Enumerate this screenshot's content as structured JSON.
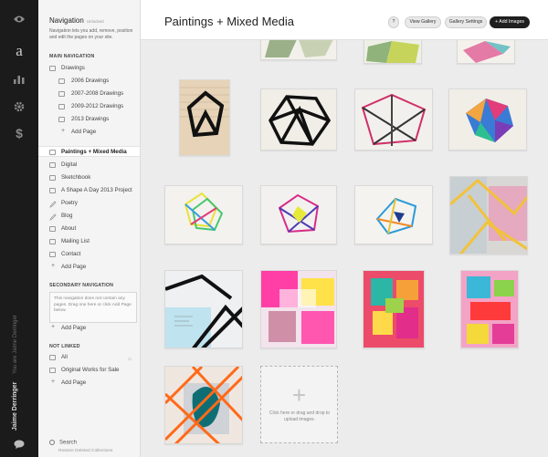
{
  "rail": {
    "icons": [
      "eye-icon",
      "logo-a-icon",
      "stats-icon",
      "settings-icon",
      "dollar-icon",
      "chat-icon"
    ],
    "logo_glyph": "a",
    "signed_in_text": "You are Jaime Derringer",
    "user_name": "Jaime Derringer"
  },
  "nav": {
    "title": "Navigation",
    "title_sub": "Unlocked",
    "description": "Navigation lets you add, remove, position and edit the pages on your site.",
    "main_heading": "MAIN NAVIGATION",
    "main_items": [
      {
        "label": "Drawings",
        "level": 0
      },
      {
        "label": "2006 Drawings",
        "level": 1
      },
      {
        "label": "2007-2008 Drawings",
        "level": 1
      },
      {
        "label": "2009-2012 Drawings",
        "level": 1
      },
      {
        "label": "2013 Drawings",
        "level": 1
      },
      {
        "label": "Add Page",
        "level": 1,
        "add": true
      },
      {
        "label": "Paintings + Mixed Media",
        "level": 0,
        "active": true
      },
      {
        "label": "Digital",
        "level": 0
      },
      {
        "label": "Sketchbook",
        "level": 0
      },
      {
        "label": "A Shape A Day 2013 Project",
        "level": 0
      },
      {
        "label": "Poetry",
        "level": 0
      },
      {
        "label": "Blog",
        "level": 0
      },
      {
        "label": "About",
        "level": 0
      },
      {
        "label": "Mailing List",
        "level": 0
      },
      {
        "label": "Contact",
        "level": 0
      },
      {
        "label": "Add Page",
        "level": 0,
        "add": true
      }
    ],
    "secondary_heading": "SECONDARY NAVIGATION",
    "secondary_note": "This navigation does not contain any pages. Drag one here or click Add Page below.",
    "secondary_add": "Add Page",
    "notlinked_heading": "NOT LINKED",
    "notlinked_items": [
      {
        "label": "All",
        "home": true
      },
      {
        "label": "Original Works for Sale"
      },
      {
        "label": "Add Page",
        "add": true
      }
    ],
    "search_label": "Search",
    "restore_label": "Restore Deleted Collections"
  },
  "header": {
    "page_title": "Paintings + Mixed Media",
    "help_label": "?",
    "view_gallery": "View Gallery",
    "gallery_settings": "Gallery Settings",
    "add_images": "+ Add Images"
  },
  "upload": {
    "plus": "+",
    "text": "Click here or drag and drop to upload images."
  }
}
